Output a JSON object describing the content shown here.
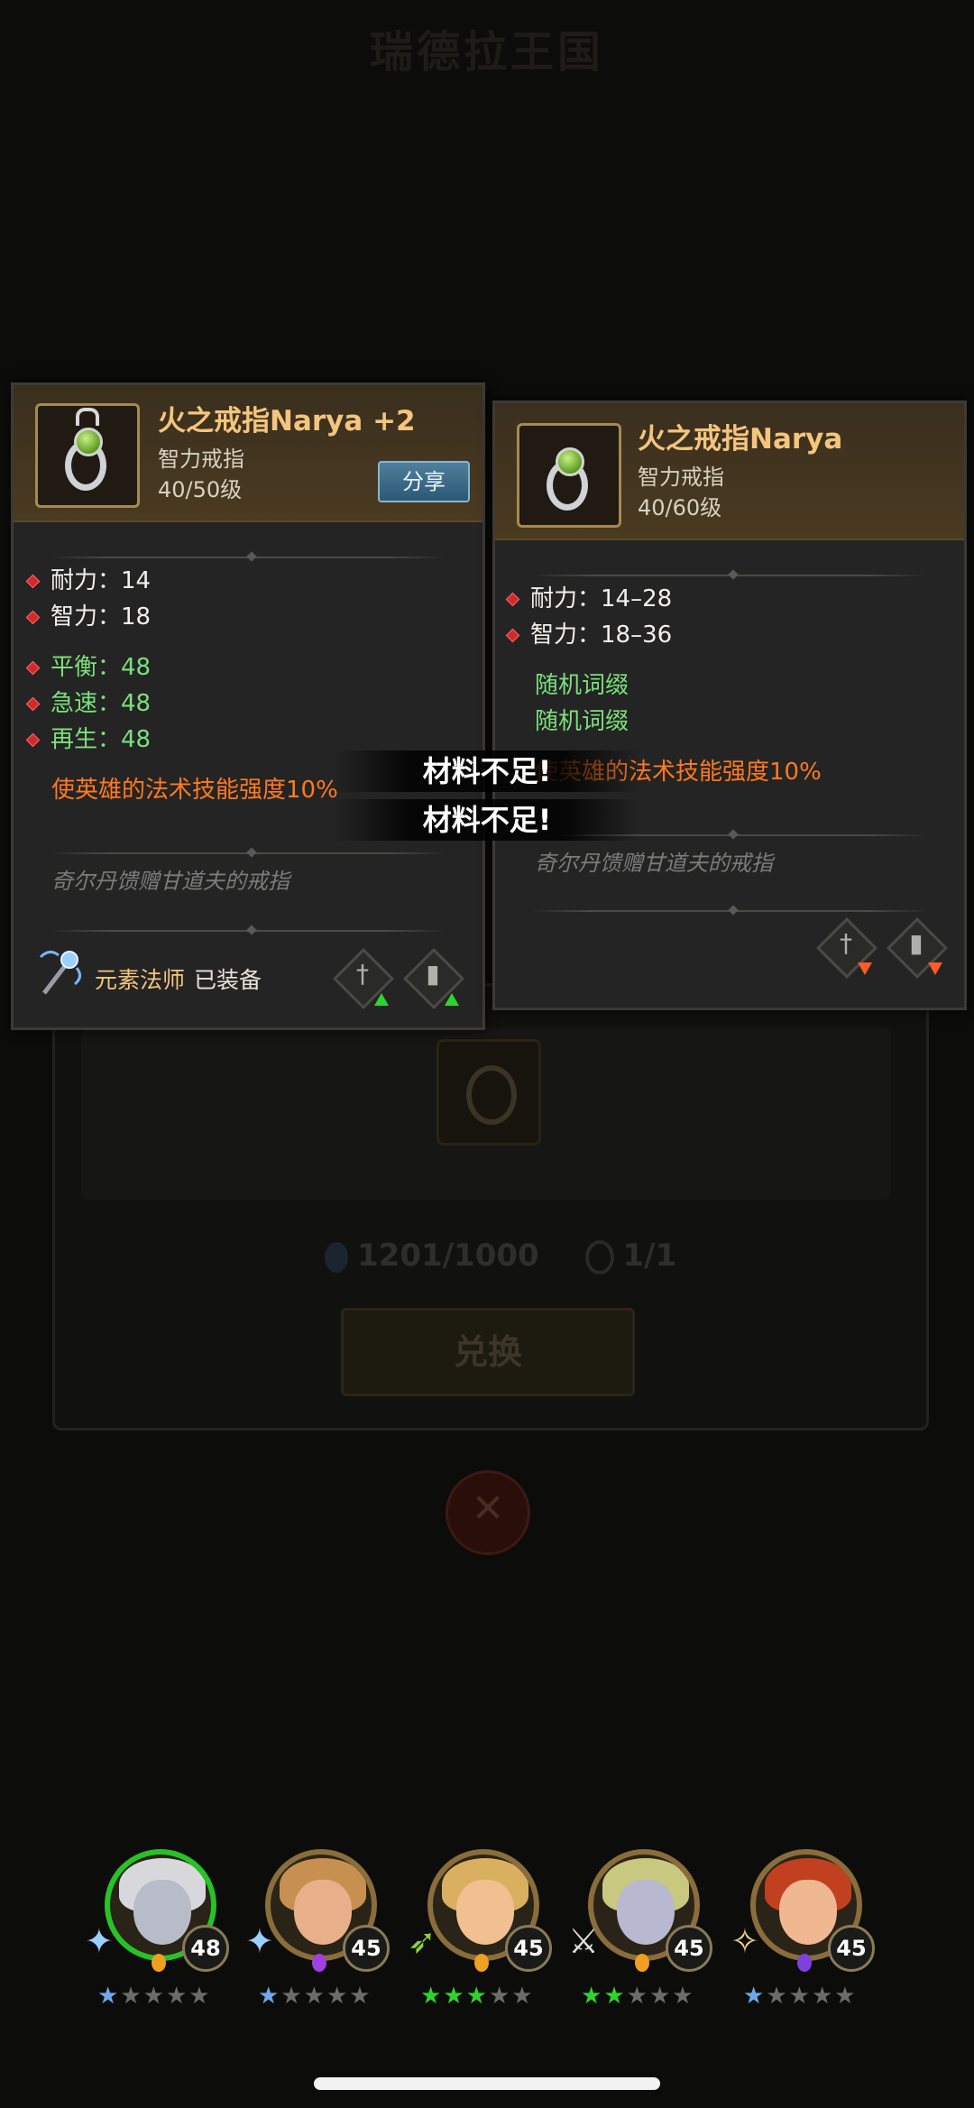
{
  "background": {
    "title": "瑞德拉王国",
    "costs": {
      "essence": "1201/1000",
      "ring_count": "1/1"
    },
    "exchange_label": "兑换"
  },
  "equipped_card": {
    "name": "火之戒指Narya +2",
    "type": "智力戒指",
    "level": "40/50级",
    "share_label": "分享",
    "base_stats": [
      {
        "label": "耐力：14"
      },
      {
        "label": "智力：18"
      }
    ],
    "bonus_stats": [
      {
        "label": "平衡：48"
      },
      {
        "label": "急速：48"
      },
      {
        "label": "再生：48"
      }
    ],
    "special": "使英雄的法术技能强度10%",
    "lore": "奇尔丹馈赠甘道夫的戒指",
    "equipped_by": "元素法师",
    "equipped_status": "已装备"
  },
  "compare_card": {
    "name": "火之戒指Narya",
    "type": "智力戒指",
    "level": "40/60级",
    "base_stats": [
      {
        "label": "耐力：14–28"
      },
      {
        "label": "智力：18–36"
      }
    ],
    "random_affixes": [
      "随机词缀",
      "随机词缀"
    ],
    "special": "使英雄的法术技能强度10%",
    "lore": "奇尔丹馈赠甘道夫的戒指"
  },
  "toasts": [
    "材料不足!",
    "材料不足!"
  ],
  "heroes": [
    {
      "level": "48",
      "stars": "★★★★★",
      "lit": 1,
      "selected": true,
      "skin": "#b8bcc8",
      "hair": "#d8d8dc",
      "weapon": "staff",
      "gem": "#f0a020"
    },
    {
      "level": "45",
      "stars": "★★★★★",
      "lit": 1,
      "selected": false,
      "skin": "#e8b08a",
      "hair": "#c89050",
      "weapon": "staff",
      "gem": "#a040e0"
    },
    {
      "level": "45",
      "stars": "★★★★★",
      "lit": 3,
      "selected": false,
      "skin": "#f0c090",
      "hair": "#d8b060",
      "weapon": "bow",
      "gem": "#f0a020"
    },
    {
      "level": "45",
      "stars": "★★★★★",
      "lit": 2,
      "selected": false,
      "skin": "#b8b8d0",
      "hair": "#c8c880",
      "weapon": "sword",
      "gem": "#f0a020"
    },
    {
      "level": "45",
      "stars": "★★★★★",
      "lit": 1,
      "selected": false,
      "skin": "#f0b890",
      "hair": "#c04020",
      "weapon": "blade",
      "gem": "#8040e0"
    }
  ],
  "colors": {
    "name_gold": "#f4c57e",
    "stat_green": "#7be07a",
    "special_orange": "#ff7a1e",
    "star_lit_blue": "#6fa8e8",
    "star_lit_green": "#2ed42e",
    "star_dim": "#6c6c6a"
  }
}
